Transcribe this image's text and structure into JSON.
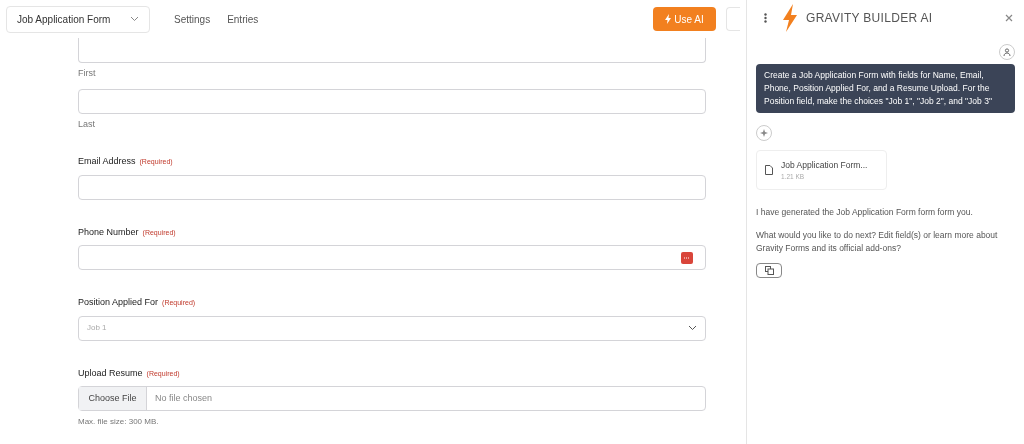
{
  "topbar": {
    "form_selector": "Job Application Form",
    "nav": [
      {
        "label": "Settings",
        "selected": false
      },
      {
        "label": "Entries",
        "selected": false
      }
    ],
    "use_ai_button": "Use AI"
  },
  "name_inputs": [
    {
      "sublabel": "First"
    },
    {
      "sublabel": "Last"
    }
  ],
  "fields": [
    {
      "kind": "email",
      "label": "Email Address",
      "required": "(Required)"
    },
    {
      "kind": "phone",
      "label": "Phone Number",
      "required": "(Required)"
    },
    {
      "kind": "select",
      "label": "Position Applied For",
      "required": "(Required)",
      "placeholder": "Job 1"
    },
    {
      "kind": "file",
      "label": "Upload Resume",
      "required": "(Required)",
      "button": "Choose File",
      "status": "No file chosen",
      "hint": "Max. file size: 300 MB."
    }
  ],
  "assistant": {
    "title": "GRAVITY BUILDER AI",
    "user_message": "Create a Job Application Form with fields for Name, Email, Phone, Position Applied For, and a Resume Upload. For the Position field, make the choices \"Job 1\", \"Job 2\", and \"Job 3\"",
    "attachment": {
      "name": "Job Application Form...",
      "size": "1.21 KB"
    },
    "replies": [
      "I have generated the Job Application Form form form you.",
      "What would you like to do next? Edit field(s) or learn more about Gravity Forms and its official add-ons?"
    ]
  }
}
